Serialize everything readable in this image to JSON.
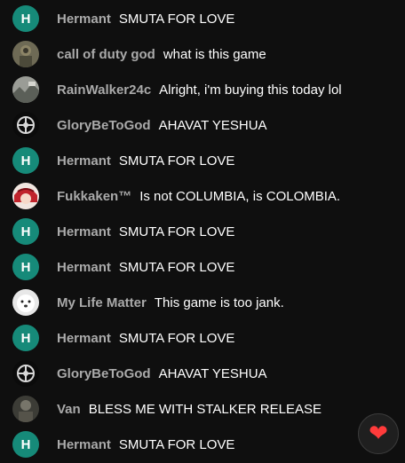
{
  "chat": {
    "messages": [
      {
        "author": "Hermant",
        "text": "SMUTA FOR LOVE",
        "avatar": {
          "type": "letter",
          "letter": "H",
          "color": "#168a79"
        }
      },
      {
        "author": "call of duty god",
        "text": "what is this game",
        "avatar": {
          "type": "photo",
          "icon": "soldier-avatar-icon"
        }
      },
      {
        "author": "RainWalker24c",
        "text": "Alright, i'm buying this today lol",
        "avatar": {
          "type": "photo",
          "icon": "scenery-avatar-icon"
        }
      },
      {
        "author": "GloryBeToGod",
        "text": "AHAVAT YESHUA",
        "avatar": {
          "type": "photo",
          "icon": "emblem-avatar-icon"
        }
      },
      {
        "author": "Hermant",
        "text": "SMUTA FOR LOVE",
        "avatar": {
          "type": "letter",
          "letter": "H",
          "color": "#168a79"
        }
      },
      {
        "author": "Fukkaken™",
        "text": "Is not COLUMBIA, is COLOMBIA.",
        "avatar": {
          "type": "photo",
          "icon": "anime-girl-avatar-icon"
        }
      },
      {
        "author": "Hermant",
        "text": "SMUTA FOR LOVE",
        "avatar": {
          "type": "letter",
          "letter": "H",
          "color": "#168a79"
        }
      },
      {
        "author": "Hermant",
        "text": "SMUTA FOR LOVE",
        "avatar": {
          "type": "letter",
          "letter": "H",
          "color": "#168a79"
        }
      },
      {
        "author": "My Life Matter",
        "text": "This game is too jank.",
        "avatar": {
          "type": "photo",
          "icon": "white-dog-avatar-icon"
        }
      },
      {
        "author": "Hermant",
        "text": "SMUTA FOR LOVE",
        "avatar": {
          "type": "letter",
          "letter": "H",
          "color": "#168a79"
        }
      },
      {
        "author": "GloryBeToGod",
        "text": "AHAVAT YESHUA",
        "avatar": {
          "type": "photo",
          "icon": "emblem-avatar-icon"
        }
      },
      {
        "author": "Van",
        "text": "BLESS ME WITH STALKER RELEASE",
        "avatar": {
          "type": "photo",
          "icon": "dark-figure-avatar-icon"
        }
      },
      {
        "author": "Hermant",
        "text": "SMUTA FOR LOVE",
        "avatar": {
          "type": "letter",
          "letter": "H",
          "color": "#168a79"
        }
      }
    ]
  },
  "reaction_button": {
    "icon": "heart-icon",
    "glyph": "❤",
    "color": "#ff3b3b"
  }
}
